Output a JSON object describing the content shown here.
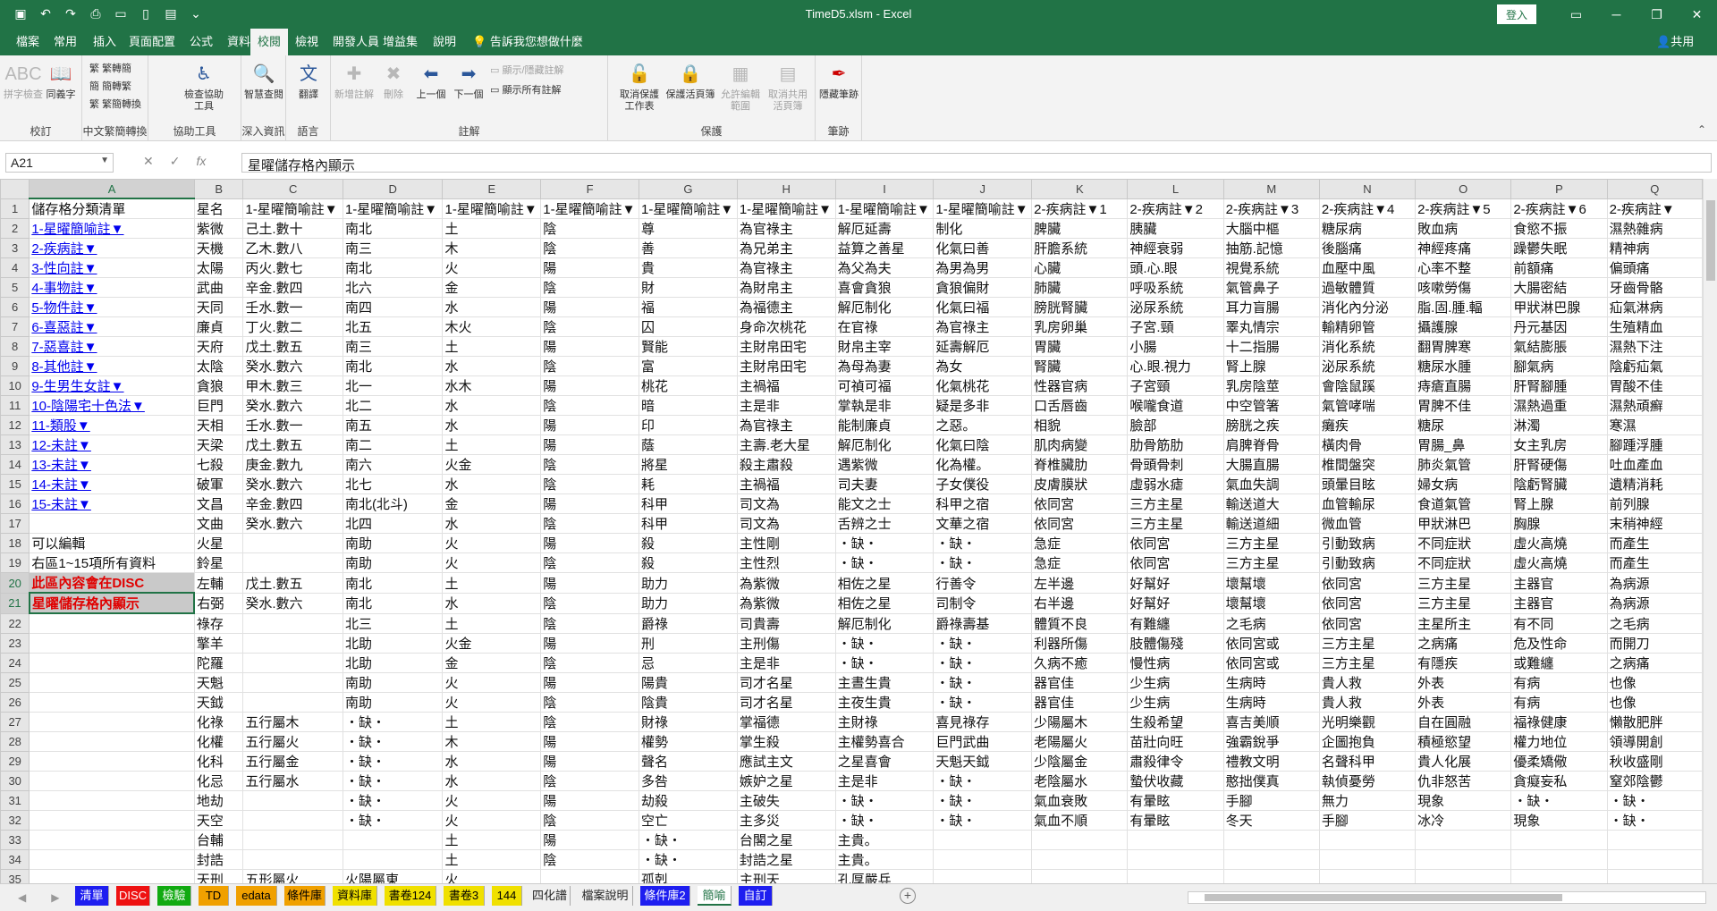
{
  "window": {
    "title": "TimeD5.xlsm - Excel",
    "login": "登入",
    "share": "共用"
  },
  "tabs": [
    "檔案",
    "常用",
    "插入",
    "頁面配置",
    "公式",
    "資料",
    "校閱",
    "檢視",
    "開發人員",
    "增益集",
    "說明",
    "告訴我您想做什麼"
  ],
  "ribbon": {
    "proofing": {
      "label": "校訂",
      "spell": "拼字檢查",
      "thesaurus": "同義字"
    },
    "chinese": {
      "label": "中文繁簡轉換",
      "t2s": "繁轉簡",
      "s2t": "簡轉繁",
      "convert": "繁簡轉換"
    },
    "accessibility": {
      "label": "協助工具",
      "check": "檢查協助工具"
    },
    "insights": {
      "label": "深入資訊",
      "smart": "智慧查閱"
    },
    "language": {
      "label": "語言",
      "translate": "翻譯"
    },
    "comments": {
      "label": "註解",
      "new": "新增註解",
      "delete": "刪除",
      "prev": "上一個",
      "next": "下一個",
      "show_hide": "顯示/隱藏註解",
      "show_all": "顯示所有註解"
    },
    "protect": {
      "label": "保護",
      "unprotect_sheet": "取消保護工作表",
      "protect_workbook": "保護活頁簿",
      "allow_edit": "允許編輯範圍",
      "unshare": "取消共用活頁簿"
    },
    "ink": {
      "label": "筆跡",
      "hide_ink": "隱藏筆跡"
    }
  },
  "namebox": "A21",
  "formula": "星曜儲存格內顯示",
  "columns": [
    "A",
    "B",
    "C",
    "D",
    "E",
    "F",
    "G",
    "H",
    "I",
    "J",
    "K",
    "L",
    "M",
    "N",
    "O",
    "P",
    "Q"
  ],
  "rows": [
    [
      "儲存格分類清單",
      "星名",
      "1-星曜簡喻註▼",
      "1-星曜簡喻註▼",
      "1-星曜簡喻註▼",
      "1-星曜簡喻註▼",
      "1-星曜簡喻註▼",
      "1-星曜簡喻註▼",
      "1-星曜簡喻註▼",
      "1-星曜簡喻註▼",
      "2-疾病註▼1",
      "2-疾病註▼2",
      "2-疾病註▼3",
      "2-疾病註▼4",
      "2-疾病註▼5",
      "2-疾病註▼6",
      "2-疾病註▼"
    ],
    [
      "1-星曜簡喻註▼",
      "紫微",
      "己土.數十",
      "南北",
      "土",
      "陰",
      "尊",
      "為官祿主",
      "解厄延壽",
      "制化",
      "脾臟",
      "胰臟",
      "大腦中樞",
      "糖尿病",
      "敗血病",
      "食慾不振",
      "濕熱雜病"
    ],
    [
      "2-疾病註▼",
      "天機",
      "乙木.數八",
      "南三",
      "木",
      "陰",
      "善",
      "為兄弟主",
      "益算之善星",
      "化氣曰善",
      "肝膽系統",
      "神經衰弱",
      "抽筋.記憶",
      "後腦痛",
      "神經疼痛",
      "躁鬱失眠",
      "精神病"
    ],
    [
      "3-性向註▼",
      "太陽",
      "丙火.數七",
      "南北",
      "火",
      "陽",
      "貴",
      "為官祿主",
      "為父為夫",
      "為男為男",
      "心臟",
      "頭.心.眼",
      "視覺系統",
      "血壓中風",
      "心率不整",
      "前額痛",
      "偏頭痛"
    ],
    [
      "4-事物註▼",
      "武曲",
      "辛金.數四",
      "北六",
      "金",
      "陰",
      "財",
      "為財帛主",
      "喜會貪狼",
      "貪狼偏財",
      "肺臟",
      "呼吸系統",
      "氣管鼻子",
      "過敏體質",
      "咳嗽勞傷",
      "大腸密結",
      "牙齒骨骼"
    ],
    [
      "5-物件註▼",
      "天同",
      "壬水.數一",
      "南四",
      "水",
      "陽",
      "福",
      "為福德主",
      "解厄制化",
      "化氣曰福",
      "膀胱腎臟",
      "泌尿系統",
      "耳力盲腸",
      "消化內分泌",
      "脂.固.腫.輻",
      "甲狀淋巴腺",
      "疝氣淋病"
    ],
    [
      "6-喜惡註▼",
      "廉貞",
      "丁火.數二",
      "北五",
      "木火",
      "陰",
      "囚",
      "身命次桃花",
      "在官祿",
      "為官祿主",
      "乳房卵巢",
      "子宮.頸",
      "睪丸情宗",
      "輸精卵管",
      "攝護腺",
      "丹元基因",
      "生殖精血"
    ],
    [
      "7-惡喜註▼",
      "天府",
      "戊土.數五",
      "南三",
      "土",
      "陽",
      "賢能",
      "主財帛田宅",
      "財帛主宰",
      "延壽解厄",
      "胃臟",
      "小腸",
      "十二指腸",
      "消化系統",
      "翻胃脾寒",
      "氣結膨脹",
      "濕熱下注"
    ],
    [
      "8-其他註▼",
      "太陰",
      "癸水.數六",
      "南北",
      "水",
      "陰",
      "富",
      "主財帛田宅",
      "為母為妻",
      "為女",
      "腎臟",
      "心.眼.視力",
      "腎上腺",
      "泌尿系統",
      "糖尿水腫",
      "腳氣病",
      "陰虧疝氣"
    ],
    [
      "9-生男生女註▼",
      "貪狼",
      "甲木.數三",
      "北一",
      "水木",
      "陽",
      "桃花",
      "主禍福",
      "可禎可福",
      "化氣桃花",
      "性器官病",
      "子宮頸",
      "乳房陰莖",
      "會陰鼠蹊",
      "痔瘡直腸",
      "肝腎腳腫",
      "胃酸不佳"
    ],
    [
      "10-陰陽宅十色法▼",
      "巨門",
      "癸水.數六",
      "北二",
      "水",
      "陰",
      "暗",
      "主是非",
      "掌執是非",
      "疑是多非",
      "口舌唇齒",
      "喉嚨食道",
      "中空管箸",
      "氣管哮喘",
      "胃脾不佳",
      "濕熱過重",
      "濕熱頑癬"
    ],
    [
      "11-類股▼",
      "天相",
      "壬水.數一",
      "南五",
      "水",
      "陽",
      "印",
      "為官祿主",
      "能制廉貞",
      "之惡。",
      "相貌",
      "臉部",
      "膀胱之疾",
      "癱疾",
      "糖尿",
      "淋濁",
      "寒濕"
    ],
    [
      "12-未註▼",
      "天梁",
      "戊土.數五",
      "南二",
      "土",
      "陽",
      "蔭",
      "主壽.老大星",
      "解厄制化",
      "化氣曰陰",
      "肌肉病變",
      "肋骨筋肋",
      "肩脾脊骨",
      "橫肉骨",
      "胃腸_鼻",
      "女主乳房",
      "腳踵浮腫"
    ],
    [
      "13-未註▼",
      "七殺",
      "庚金.數九",
      "南六",
      "火金",
      "陰",
      "將星",
      "殺主肅殺",
      "遇紫微",
      "化為權。",
      "脊椎臟肋",
      "骨頭骨刺",
      "大腸直腸",
      "椎間盤突",
      "肺炎氣管",
      "肝腎硬傷",
      "吐血產血"
    ],
    [
      "14-未註▼",
      "破軍",
      "癸水.數六",
      "北七",
      "水",
      "陰",
      "耗",
      "主禍福",
      "司夫妻",
      "子女僕役",
      "皮膚膜狀",
      "虛弱水瘧",
      "氣血失調",
      "頭暈目眩",
      "婦女病",
      "陰虧腎臟",
      "遺精消耗"
    ],
    [
      "15-未註▼",
      "文昌",
      "辛金.數四",
      "南北(北斗)",
      "金",
      "陽",
      "科甲",
      "司文為",
      "能文之士",
      "科甲之宿",
      "依同宮",
      "三方主星",
      "輸送道大",
      "血管輸尿",
      "食道氣管",
      "腎上腺",
      "前列腺"
    ],
    [
      "",
      "文曲",
      "癸水.數六",
      "北四",
      "水",
      "陰",
      "科甲",
      "司文為",
      "舌辨之士",
      "文華之宿",
      "依同宮",
      "三方主星",
      "輸送道細",
      "微血管",
      "甲狀淋巴",
      "胸腺",
      "末稍神經"
    ],
    [
      "可以編輯",
      "火星",
      "",
      "南助",
      "火",
      "陽",
      "殺",
      "主性剛",
      "・缺・",
      "・缺・",
      "急症",
      "依同宮",
      "三方主星",
      "引動致病",
      "不同症狀",
      "虛火高燒",
      "而產生"
    ],
    [
      "右區1~15項所有資料",
      "鈴星",
      "",
      "南助",
      "火",
      "陰",
      "殺",
      "主性烈",
      "・缺・",
      "・缺・",
      "急症",
      "依同宮",
      "三方主星",
      "引動致病",
      "不同症狀",
      "虛火高燒",
      "而產生"
    ],
    [
      "此區內容會在DISC",
      "左輔",
      "戊土.數五",
      "南北",
      "土",
      "陽",
      "助力",
      "為紫微",
      "相佐之星",
      "行善令",
      "左半邊",
      "好幫好",
      "壞幫壞",
      "依同宮",
      "三方主星",
      "主器官",
      "為病源"
    ],
    [
      "星曜儲存格內顯示",
      "右弼",
      "癸水.數六",
      "南北",
      "水",
      "陰",
      "助力",
      "為紫微",
      "相佐之星",
      "司制令",
      "右半邊",
      "好幫好",
      "壞幫壞",
      "依同宮",
      "三方主星",
      "主器官",
      "為病源"
    ],
    [
      "",
      "祿存",
      "",
      "北三",
      "土",
      "陰",
      "爵祿",
      "司貴壽",
      "解厄制化",
      "爵祿壽基",
      "體質不良",
      "有難纏",
      "之毛病",
      "依同宮",
      "主星所主",
      "有不同",
      "之毛病"
    ],
    [
      "",
      "擎羊",
      "",
      "北助",
      "火金",
      "陽",
      "刑",
      "主刑傷",
      "・缺・",
      "・缺・",
      "利器所傷",
      "肢體傷殘",
      "依同宮或",
      "三方主星",
      "之病痛",
      "危及性命",
      "而開刀"
    ],
    [
      "",
      "陀羅",
      "",
      "北助",
      "金",
      "陰",
      "忌",
      "主是非",
      "・缺・",
      "・缺・",
      "久病不癒",
      "慢性病",
      "依同宮或",
      "三方主星",
      "有隱疾",
      "或難纏",
      "之病痛"
    ],
    [
      "",
      "天魁",
      "",
      "南助",
      "火",
      "陽",
      "陽貴",
      "司才名星",
      "主晝生貴",
      "・缺・",
      "器官佳",
      "少生病",
      "生病時",
      "貴人救",
      "外表",
      "有病",
      "也像"
    ],
    [
      "",
      "天鉞",
      "",
      "南助",
      "火",
      "陰",
      "陰貴",
      "司才名星",
      "主夜生貴",
      "・缺・",
      "器官佳",
      "少生病",
      "生病時",
      "貴人救",
      "外表",
      "有病",
      "也像"
    ],
    [
      "",
      "化祿",
      "五行屬木",
      "・缺・",
      "土",
      "陰",
      "財祿",
      "掌福德",
      "主財祿",
      "喜見祿存",
      "少陽屬木",
      "生殺希望",
      "喜吉美順",
      "光明樂觀",
      "自在圓融",
      "福祿健康",
      "懶散肥胖"
    ],
    [
      "",
      "化權",
      "五行屬火",
      "・缺・",
      "木",
      "陽",
      "權勢",
      "掌生殺",
      "主權勢喜合",
      "巨門武曲",
      "老陽屬火",
      "苗壯向旺",
      "強霸銳爭",
      "企圖抱負",
      "積極慾望",
      "權力地位",
      "領導開創"
    ],
    [
      "",
      "化科",
      "五行屬金",
      "・缺・",
      "水",
      "陽",
      "聲名",
      "應試主文",
      "之星喜會",
      "天魁天鉞",
      "少陰屬金",
      "肅殺律令",
      "禮教文明",
      "名聲科甲",
      "貴人化展",
      "優柔矯儆",
      "秋收盛剛"
    ],
    [
      "",
      "化忌",
      "五行屬水",
      "・缺・",
      "水",
      "陰",
      "多咎",
      "嫉妒之星",
      "主是非",
      "・缺・",
      "老陰屬水",
      "蟄伏收藏",
      "憨拙僕真",
      "執偵憂勞",
      "仇非怒苦",
      "貪癡妄私",
      "窒郊陰鬱"
    ],
    [
      "",
      "地劫",
      "",
      "・缺・",
      "火",
      "陽",
      "劫殺",
      "主破失",
      "・缺・",
      "・缺・",
      "氣血衰敗",
      "有暈眩",
      "手腳",
      "無力",
      "現象",
      "・缺・",
      "・缺・"
    ],
    [
      "",
      "天空",
      "",
      "・缺・",
      "火",
      "陰",
      "空亡",
      "主多災",
      "・缺・",
      "・缺・",
      "氣血不順",
      "有暈眩",
      "冬天",
      "手腳",
      "冰冷",
      "現象",
      "・缺・"
    ],
    [
      "",
      "台輔",
      "",
      "",
      "土",
      "陽",
      "・缺・",
      "台閣之星",
      "主貴。",
      "",
      "",
      "",
      "",
      "",
      "",
      "",
      ""
    ],
    [
      "",
      "封誥",
      "",
      "",
      "土",
      "陰",
      "・缺・",
      "封誥之星",
      "主貴。",
      "",
      "",
      "",
      "",
      "",
      "",
      "",
      ""
    ],
    [
      "",
      "天刑",
      "五形屬火",
      "火陽屬東",
      "火",
      "",
      "孤剋",
      "主刑天",
      "孔厚嚴兵",
      "",
      "",
      "",
      "",
      "",
      "",
      "",
      ""
    ]
  ],
  "sheets": [
    "清單",
    "DISC",
    "檢驗",
    "TD",
    "edata",
    "條件庫",
    "資料庫",
    "書卷124",
    "書卷3",
    "144",
    "四化譜",
    "檔案說明",
    "條件庫2",
    "簡喻",
    "自訂"
  ],
  "colors": {
    "excel_green": "#217346",
    "link_blue": "#0000ee",
    "emphasis_red": "#e00000"
  }
}
